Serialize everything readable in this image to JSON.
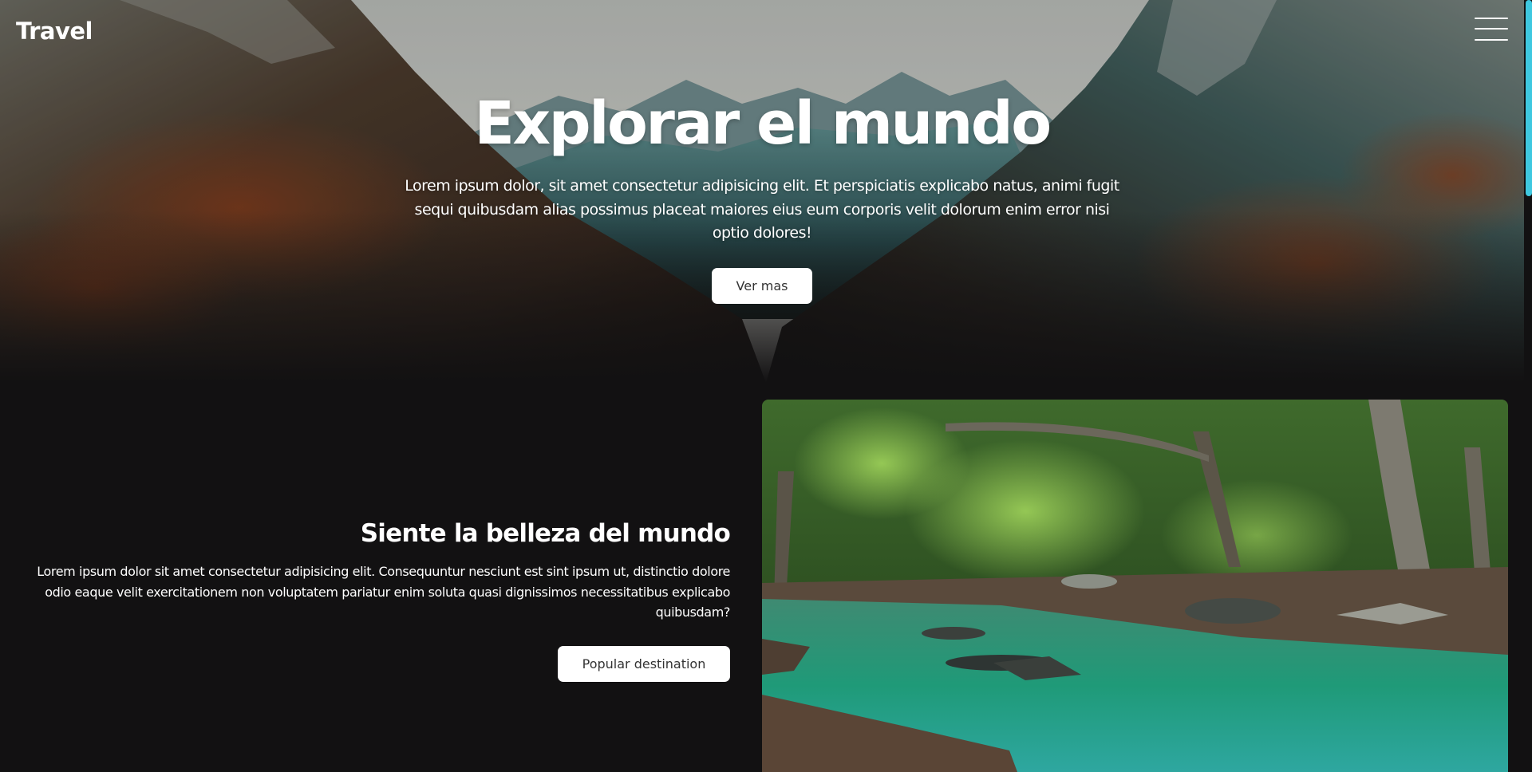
{
  "header": {
    "logo": "Travel",
    "menu_icon": "hamburger-menu-icon"
  },
  "hero": {
    "title": "Explorar el mundo",
    "text": "Lorem ipsum dolor, sit amet consectetur adipisicing elit. Et perspiciatis explicabo natus, animi fugit sequi quibusdam alias possimus placeat maiores eius eum corporis velit dolorum enim error nisi optio dolores!",
    "button_label": "Ver mas"
  },
  "feature": {
    "title": "Siente la belleza del mundo",
    "text": "Lorem ipsum dolor sit amet consectetur adipisicing elit. Consequuntur nesciunt est sint ipsum ut, distinctio dolore odio eaque velit exercitationem non voluptatem pariatur enim soluta quasi dignissimos necessitatibus explicabo quibusdam?",
    "button_label": "Popular destination"
  },
  "colors": {
    "page_background": "#121112",
    "button_background": "#ffffff",
    "button_text": "#333333",
    "scrollbar_thumb": "#3fc8e0"
  }
}
